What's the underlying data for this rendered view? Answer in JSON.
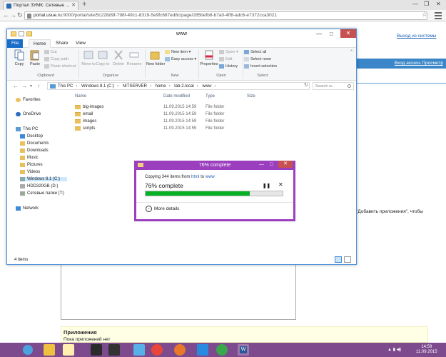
{
  "browser": {
    "tab_title": "Портал ЗУМК: Сетевые ...",
    "url_host": "portal.usue.ru",
    "url_rest": ":9000/portal/site/5c228d9f-798f-49c1-8319-5e9fc687ed8c/page/285befb8-b7a0-4ff8-adc6-e7372cca3021"
  },
  "page": {
    "logout": "Выход из системы",
    "access_link": "Вход access Просмотр",
    "add_apps_text": "\"Добавить приложения\", чтобы",
    "apps_heading": "Приложения",
    "apps_empty": "Пока приложений нет"
  },
  "explorer": {
    "title": "www",
    "tabs": [
      "File",
      "Home",
      "Share",
      "View"
    ],
    "ribbon": {
      "copy": "Copy",
      "paste": "Paste",
      "cut": "Cut",
      "copy_path": "Copy path",
      "paste_shortcut": "Paste shortcut",
      "move_to": "Move to",
      "copy_to": "Copy to",
      "delete": "Delete",
      "rename": "Rename",
      "new_folder": "New folder",
      "new_item": "New item ▾",
      "easy_access": "Easy access ▾",
      "properties": "Properties",
      "open": "Open ▾",
      "edit": "Edit",
      "history": "History",
      "select_all": "Select all",
      "select_none": "Select none",
      "invert_selection": "Invert selection",
      "group_clipboard": "Clipboard",
      "group_organize": "Organize",
      "group_new": "New",
      "group_open": "Open",
      "group_select": "Select"
    },
    "breadcrumb": [
      "This PC",
      "Windows 8.1 (C:)",
      "NITSERVER",
      "home",
      "lab-2.local",
      "www"
    ],
    "search_placeholder": "Search w...",
    "nav": [
      {
        "label": "Favorites"
      },
      {
        "label": "OneDrive"
      },
      {
        "label": "This PC"
      },
      {
        "label": "Desktop"
      },
      {
        "label": "Documents"
      },
      {
        "label": "Downloads"
      },
      {
        "label": "Music"
      },
      {
        "label": "Pictures"
      },
      {
        "label": "Videos"
      },
      {
        "label": "Windows 8.1 (C:)"
      },
      {
        "label": "HDD320GB (D:)"
      },
      {
        "label": "Сетевые папки (T:)"
      },
      {
        "label": "Network"
      }
    ],
    "columns": [
      "Name",
      "Date modified",
      "Type",
      "Size"
    ],
    "files": [
      {
        "name": "big-images",
        "date": "11.09.2015 14:59",
        "type": "File folder"
      },
      {
        "name": "email",
        "date": "11.09.2015 14:59",
        "type": "File folder"
      },
      {
        "name": "images",
        "date": "11.09.2015 14:59",
        "type": "File folder"
      },
      {
        "name": "scripts",
        "date": "11.09.2015 14:59",
        "type": "File folder"
      }
    ],
    "status": "4 items"
  },
  "copy_dialog": {
    "title": "76% complete",
    "from_prefix": "Copying 344 items from",
    "from": "html",
    "to_word": "to",
    "to": "www",
    "percent_text": "76% complete",
    "progress": 0.76,
    "more_details": "More details"
  },
  "taskbar": {
    "time": "14:59",
    "date": "11.09.2015"
  },
  "colors": {
    "dialog_accent": "#9b3fbf",
    "progress_green": "#06b025",
    "taskbar": "#7d4a8e",
    "file_tab": "#1a6ec8"
  }
}
